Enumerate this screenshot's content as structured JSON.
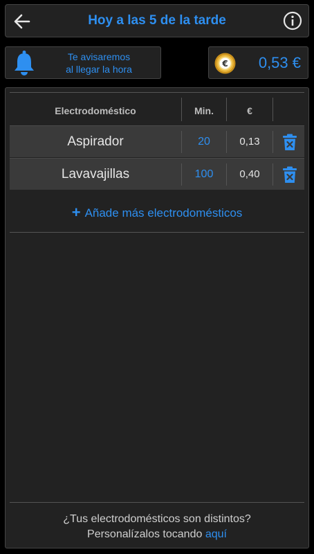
{
  "header": {
    "back_icon": "arrow-left-icon",
    "title": "Hoy a las 5 de la tarde",
    "info_icon": "info-circle-icon"
  },
  "notify": {
    "icon": "bell-icon",
    "line1": "Te avisaremos",
    "line2": "al llegar la hora"
  },
  "cost": {
    "icon": "euro-coin-icon",
    "value": "0,53 €"
  },
  "table": {
    "columns": [
      "Electrodoméstico",
      "Min.",
      "€",
      ""
    ],
    "rows": [
      {
        "name": "Aspirador",
        "minutes": "20",
        "cost": "0,13",
        "delete_icon": "trash-icon"
      },
      {
        "name": "Lavavajillas",
        "minutes": "100",
        "cost": "0,40",
        "delete_icon": "trash-icon"
      }
    ]
  },
  "add_more": {
    "icon": "plus-icon",
    "label": "Añade más electrodomésticos"
  },
  "footer": {
    "line1": "¿Tus electrodomésticos son distintos?",
    "line2_prefix": "Personalízalos tocando",
    "line2_link": "aquí"
  },
  "colors": {
    "accent": "#2e8ff0",
    "background": "#000000",
    "panel": "#222222",
    "row": "#3a3a3a",
    "coin_gold": "#e0a82a"
  }
}
